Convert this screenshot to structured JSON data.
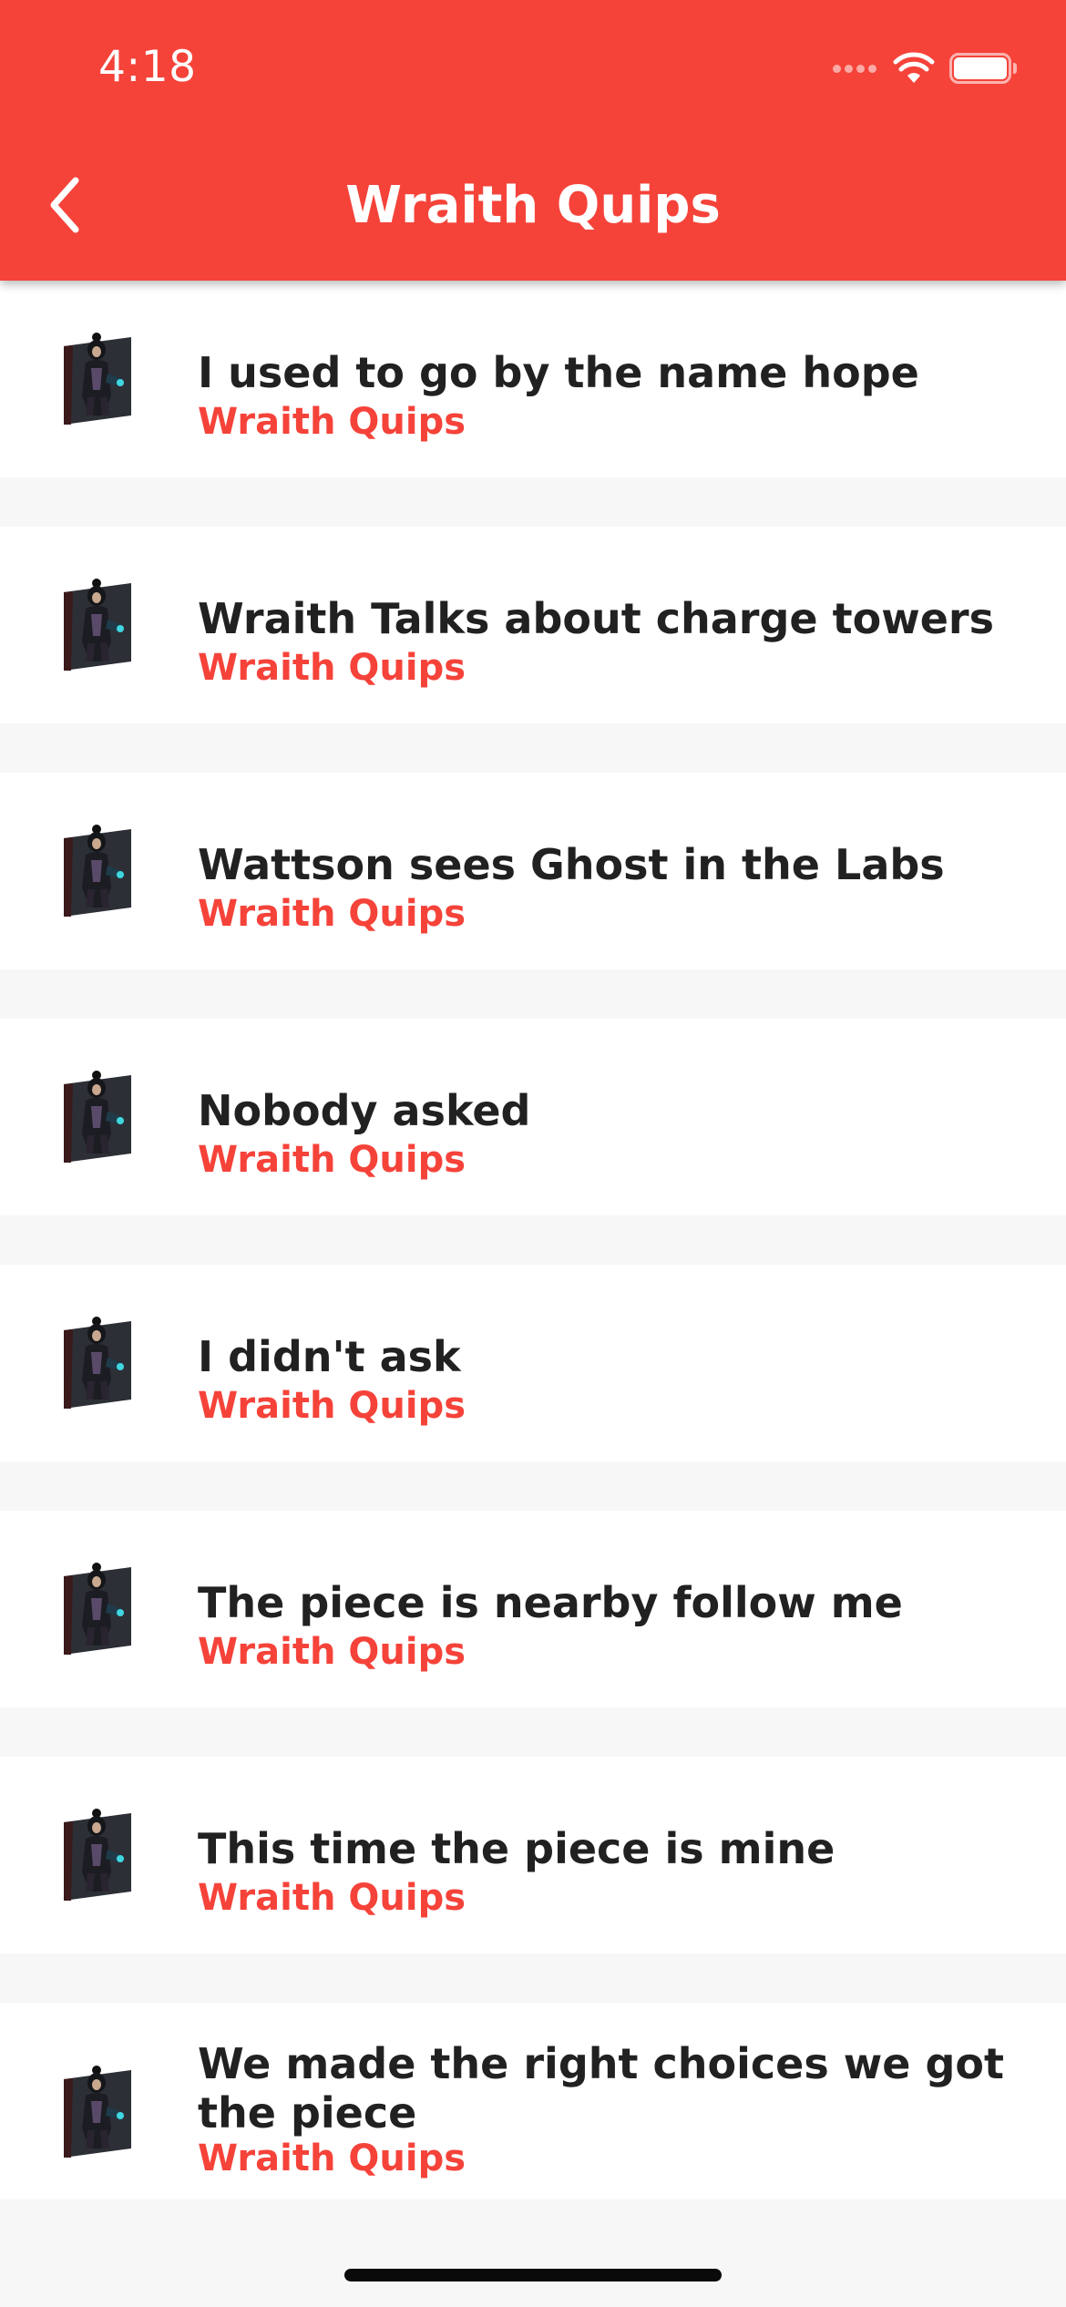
{
  "status_bar": {
    "time": "4:18",
    "icons": [
      "cellular-dots-icon",
      "wifi-icon",
      "battery-icon"
    ]
  },
  "header": {
    "title": "Wraith Quips",
    "back_icon": "chevron-left-icon"
  },
  "colors": {
    "accent": "#f5433a",
    "title_text": "#212121",
    "background": "#f7f7f7",
    "card": "#ffffff"
  },
  "items": [
    {
      "title": "I used to go by the name hope",
      "subtitle": "Wraith Quips",
      "icon": "wraith-avatar-icon"
    },
    {
      "title": "Wraith Talks about charge towers",
      "subtitle": "Wraith Quips",
      "icon": "wraith-avatar-icon"
    },
    {
      "title": "Wattson sees Ghost in the Labs",
      "subtitle": "Wraith Quips",
      "icon": "wraith-avatar-icon"
    },
    {
      "title": "Nobody asked",
      "subtitle": "Wraith Quips",
      "icon": "wraith-avatar-icon"
    },
    {
      "title": "I didn't ask",
      "subtitle": "Wraith Quips",
      "icon": "wraith-avatar-icon"
    },
    {
      "title": "The piece is nearby follow me",
      "subtitle": "Wraith Quips",
      "icon": "wraith-avatar-icon"
    },
    {
      "title": "This time the piece is mine",
      "subtitle": "Wraith Quips",
      "icon": "wraith-avatar-icon"
    },
    {
      "title": "We made the right choices we got the piece",
      "subtitle": "Wraith Quips",
      "icon": "wraith-avatar-icon"
    }
  ]
}
